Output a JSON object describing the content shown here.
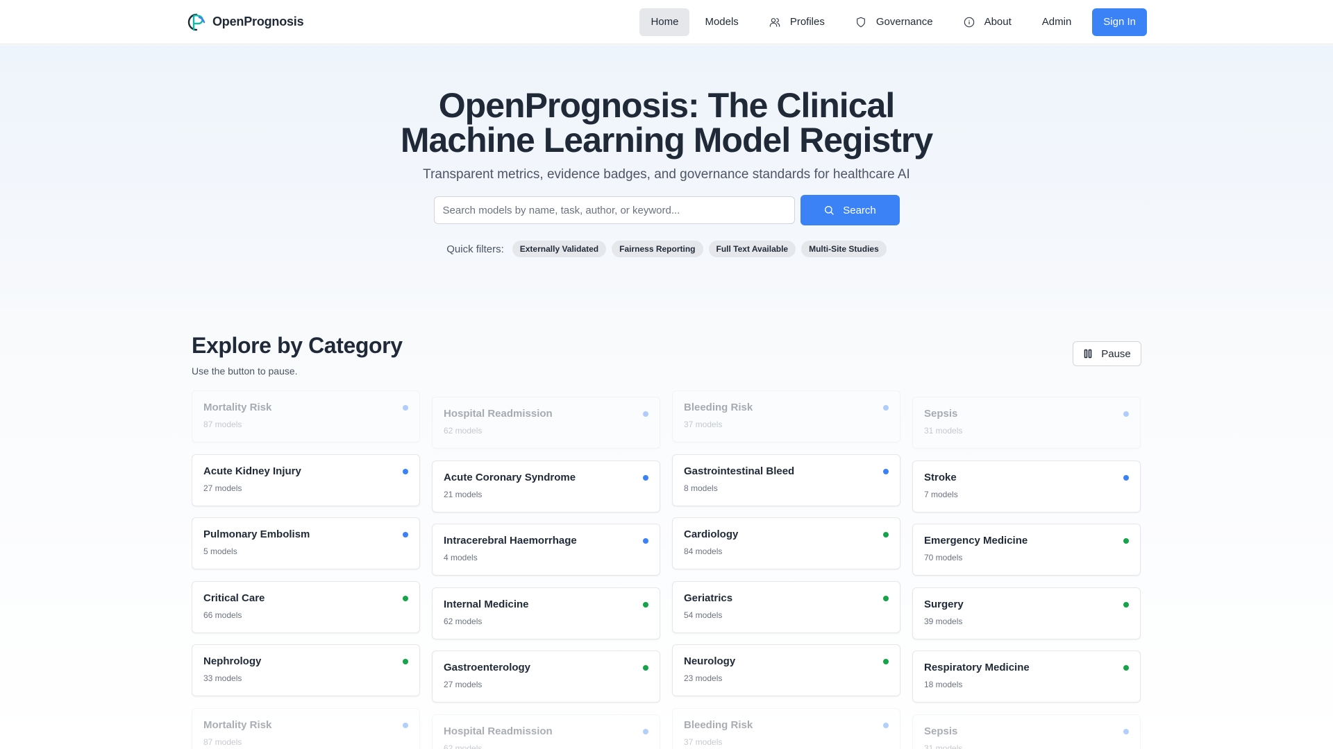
{
  "header": {
    "brand": "OpenPrognosis",
    "nav": [
      {
        "label": "Home",
        "icon": "",
        "active": true
      },
      {
        "label": "Models",
        "icon": ""
      },
      {
        "label": "Profiles",
        "icon": "users-icon"
      },
      {
        "label": "Governance",
        "icon": "shield-icon"
      },
      {
        "label": "About",
        "icon": "info-icon"
      },
      {
        "label": "Admin",
        "icon": ""
      }
    ],
    "signin_label": "Sign In"
  },
  "hero": {
    "title_line1": "OpenPrognosis: The Clinical",
    "title_line2": "Machine Learning Model Registry",
    "subtitle": "Transparent metrics, evidence badges, and governance standards for healthcare AI",
    "search_placeholder": "Search models by name, task, author, or keyword...",
    "search_label": "Search",
    "filters_label": "Quick filters:",
    "filters": [
      "Externally Validated",
      "Fairness Reporting",
      "Full Text Available",
      "Multi-Site Studies"
    ]
  },
  "categories": {
    "title": "Explore by Category",
    "subtitle": "Use the button to pause.",
    "pause_label": "Pause",
    "colors": {
      "task": "#3b82f6",
      "specialty": "#16a34a"
    },
    "columns": [
      [
        {
          "name": "Mortality Risk",
          "count": "87 models",
          "kind": "task",
          "faded": true
        },
        {
          "name": "Acute Kidney Injury",
          "count": "27 models",
          "kind": "task"
        },
        {
          "name": "Pulmonary Embolism",
          "count": "5 models",
          "kind": "task"
        },
        {
          "name": "Critical Care",
          "count": "66 models",
          "kind": "specialty"
        },
        {
          "name": "Nephrology",
          "count": "33 models",
          "kind": "specialty"
        },
        {
          "name": "Mortality Risk",
          "count": "87 models",
          "kind": "task",
          "faded": true
        }
      ],
      [
        {
          "name": "Hospital Readmission",
          "count": "62 models",
          "kind": "task",
          "faded": true
        },
        {
          "name": "Acute Coronary Syndrome",
          "count": "21 models",
          "kind": "task"
        },
        {
          "name": "Intracerebral Haemorrhage",
          "count": "4 models",
          "kind": "task"
        },
        {
          "name": "Internal Medicine",
          "count": "62 models",
          "kind": "specialty"
        },
        {
          "name": "Gastroenterology",
          "count": "27 models",
          "kind": "specialty"
        },
        {
          "name": "Hospital Readmission",
          "count": "62 models",
          "kind": "task",
          "faded": true
        }
      ],
      [
        {
          "name": "Bleeding Risk",
          "count": "37 models",
          "kind": "task",
          "faded": true
        },
        {
          "name": "Gastrointestinal Bleed",
          "count": "8 models",
          "kind": "task"
        },
        {
          "name": "Cardiology",
          "count": "84 models",
          "kind": "specialty"
        },
        {
          "name": "Geriatrics",
          "count": "54 models",
          "kind": "specialty"
        },
        {
          "name": "Neurology",
          "count": "23 models",
          "kind": "specialty"
        },
        {
          "name": "Bleeding Risk",
          "count": "37 models",
          "kind": "task",
          "faded": true
        }
      ],
      [
        {
          "name": "Sepsis",
          "count": "31 models",
          "kind": "task",
          "faded": true
        },
        {
          "name": "Stroke",
          "count": "7 models",
          "kind": "task"
        },
        {
          "name": "Emergency Medicine",
          "count": "70 models",
          "kind": "specialty"
        },
        {
          "name": "Surgery",
          "count": "39 models",
          "kind": "specialty"
        },
        {
          "name": "Respiratory Medicine",
          "count": "18 models",
          "kind": "specialty"
        },
        {
          "name": "Sepsis",
          "count": "31 models",
          "kind": "task",
          "faded": true
        }
      ]
    ]
  }
}
